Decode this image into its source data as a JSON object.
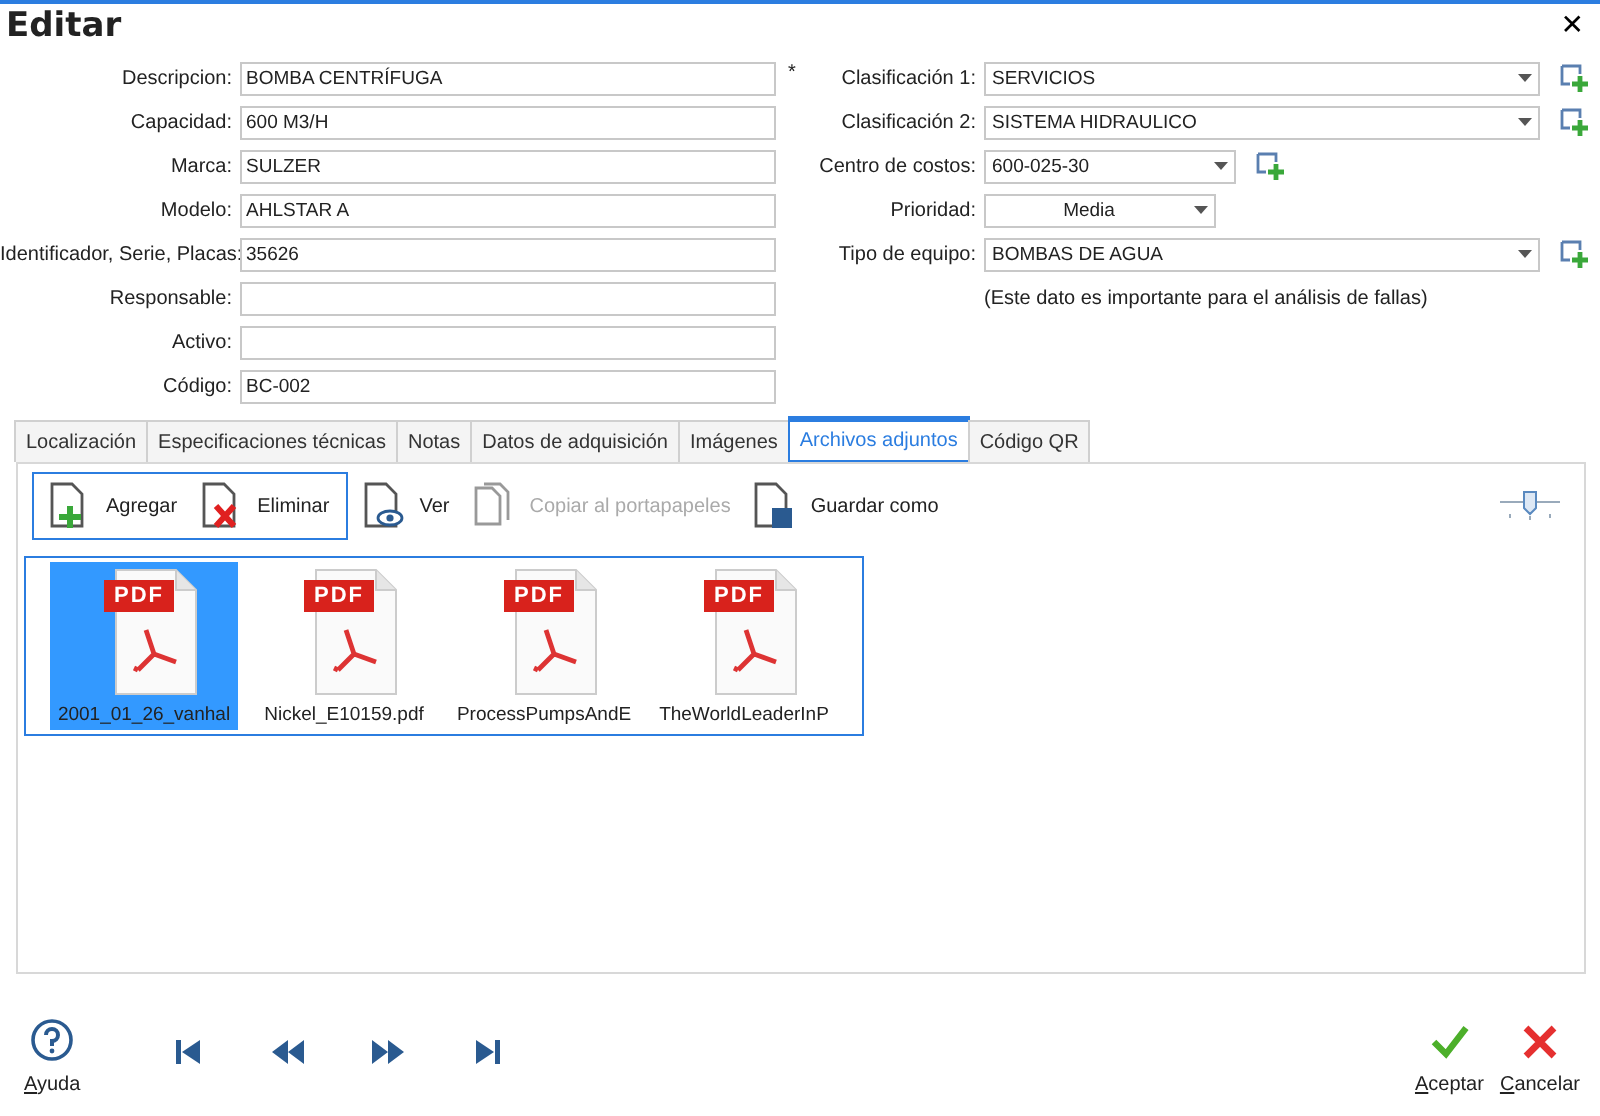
{
  "window": {
    "title": "Editar",
    "close": "✕"
  },
  "left_fields": [
    {
      "label": "Descripcion:",
      "value": "BOMBA CENTRÍFUGA",
      "required_mark": "*"
    },
    {
      "label": "Capacidad:",
      "value": "600 M3/H"
    },
    {
      "label": "Marca:",
      "value": "SULZER"
    },
    {
      "label": "Modelo:",
      "value": "AHLSTAR A"
    },
    {
      "label": "Identificador, Serie, Placas:",
      "value": "35626"
    },
    {
      "label": "Responsable:"
    },
    {
      "label": "Activo:"
    },
    {
      "label": "Código:",
      "value": "BC-002"
    }
  ],
  "right_fields": [
    {
      "label": "Clasificación 1:",
      "value": "SERVICIOS",
      "kind": "wide",
      "has_add": true
    },
    {
      "label": "Clasificación 2:",
      "value": "SISTEMA HIDRAULICO",
      "kind": "wide",
      "has_add": true
    },
    {
      "label": "Centro de costos:",
      "value": "600-025-30",
      "kind": "narrow",
      "has_add": true
    },
    {
      "label": "Prioridad:",
      "value": "Media",
      "kind": "centered",
      "has_add": false
    },
    {
      "label": "Tipo de equipo:",
      "value": "BOMBAS DE AGUA",
      "kind": "wide",
      "has_add": true
    }
  ],
  "note": "(Este dato es importante para el análisis de fallas)",
  "tabs": [
    {
      "label": "Localización",
      "selected": false
    },
    {
      "label": "Especificaciones técnicas",
      "selected": false
    },
    {
      "label": "Notas",
      "selected": false
    },
    {
      "label": "Datos de adquisición",
      "selected": false
    },
    {
      "label": "Imágenes",
      "selected": false
    },
    {
      "label": "Archivos adjuntos",
      "selected": true
    },
    {
      "label": "Código QR",
      "selected": false
    }
  ],
  "toolbar": {
    "group": [
      {
        "label": "Agregar",
        "kind": "add",
        "disabled": false
      },
      {
        "label": "Eliminar",
        "kind": "delete",
        "disabled": false
      }
    ],
    "items": [
      {
        "label": "Ver",
        "kind": "view",
        "disabled": false
      },
      {
        "label": "Copiar al portapapeles",
        "kind": "copy",
        "disabled": true
      },
      {
        "label": "Guardar como",
        "kind": "save",
        "disabled": false
      }
    ]
  },
  "files": [
    {
      "name": "2001_01_26_vanhal",
      "badge": "PDF",
      "selected": true
    },
    {
      "name": "Nickel_E10159.pdf",
      "badge": "PDF",
      "selected": false
    },
    {
      "name": "ProcessPumpsAndE",
      "badge": "PDF",
      "selected": false
    },
    {
      "name": "TheWorldLeaderInP",
      "badge": "PDF",
      "selected": false
    }
  ],
  "footer": {
    "help": "Ayuda",
    "nav": [
      {
        "kind": "first"
      },
      {
        "kind": "prev"
      },
      {
        "kind": "next"
      },
      {
        "kind": "last"
      }
    ],
    "ok": "Aceptar",
    "cancel": "Cancelar"
  }
}
